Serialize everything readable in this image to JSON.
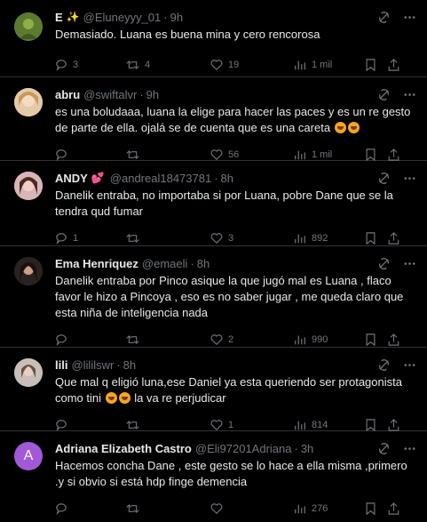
{
  "tweets": [
    {
      "name": "E",
      "name_suffix": "✨",
      "handle": "@Eluneyyy_01",
      "time": "9h",
      "text": "Demasiado. Luana es buena mina y cero rencorosa",
      "replies": "3",
      "retweets": "4",
      "likes": "19",
      "views": "1 mil",
      "avatar_color": "#6a8a3a"
    },
    {
      "name": "abru",
      "handle": "@swiftalvr",
      "time": "9h",
      "text": "es una boludaaa, luana la elige para hacer las paces y es un re gesto de parte de ella. ojalá se de cuenta que es una careta",
      "replies": "",
      "retweets": "",
      "likes": "56",
      "views": "1 mil",
      "avatar_color": "#d9b48f"
    },
    {
      "name": "ANDY",
      "name_suffix": "💕",
      "handle": "@andreal18473781",
      "time": "8h",
      "text": "Danelik entraba, no importaba si por Luana, pobre Dane que se la tendra qud fumar",
      "replies": "1",
      "retweets": "",
      "likes": "3",
      "views": "892",
      "avatar_color": "#c9a0a8"
    },
    {
      "name": "Ema Henriquez",
      "handle": "@emaeli",
      "time": "8h",
      "text": "Danelik entraba por Pinco asique la que jugó mal es Luana , flaco favor le hizo a Pincoya , eso es no saber jugar , me queda claro que esta niña de inteligencia nada",
      "replies": "",
      "retweets": "",
      "likes": "2",
      "views": "990",
      "avatar_color": "#3a2a2a"
    },
    {
      "name": "lili",
      "handle": "@lililswr",
      "time": "8h",
      "text_a": "Que mal q eligió luna,ese Daniel ya esta queriendo ser protagonista como tini",
      "text_b": "la va re perjudicar",
      "replies": "",
      "retweets": "",
      "likes": "1",
      "views": "814",
      "avatar_color": "#b8b0a8"
    },
    {
      "name": "Adriana Elizabeth Castro",
      "handle": "@Eli97201Adriana",
      "time": "3h",
      "avatar_letter": "A",
      "text": "Hacemos concha Dane ,  este gesto se lo hace a ella misma ,primero .y  si obvio si está hdp finge demencia",
      "replies": "",
      "retweets": "",
      "likes": "",
      "views": "276",
      "avatar_color": "#a259d9"
    }
  ],
  "icons": {
    "header": [
      "grok-icon",
      "more-icon"
    ],
    "actions": [
      "reply-icon",
      "retweet-icon",
      "like-icon",
      "views-icon",
      "bookmark-icon",
      "share-icon"
    ]
  }
}
